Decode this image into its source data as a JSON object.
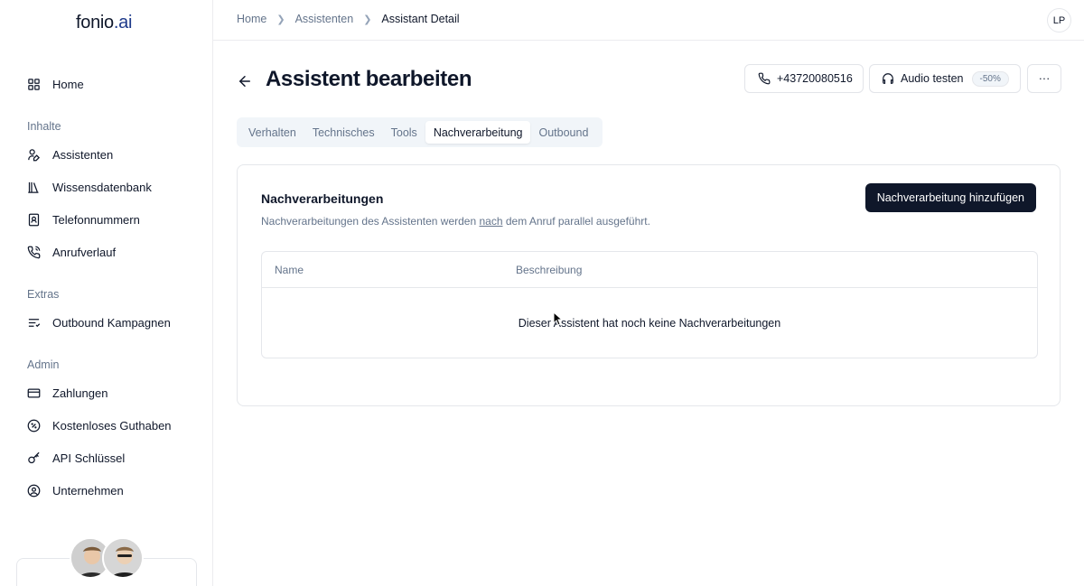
{
  "sidebar": {
    "logo_main": "fonio",
    "logo_ext": ".ai",
    "home": {
      "label": "Home",
      "icon": "grid-icon"
    },
    "sections": [
      {
        "title": "Inhalte",
        "items": [
          {
            "label": "Assistenten",
            "icon": "user-edit-icon"
          },
          {
            "label": "Wissensdatenbank",
            "icon": "library-icon"
          },
          {
            "label": "Telefonnummern",
            "icon": "contact-icon"
          },
          {
            "label": "Anrufverlauf",
            "icon": "phone-call-icon"
          }
        ]
      },
      {
        "title": "Extras",
        "items": [
          {
            "label": "Outbound Kampagnen",
            "icon": "list-icon"
          }
        ]
      },
      {
        "title": "Admin",
        "items": [
          {
            "label": "Zahlungen",
            "icon": "credit-card-icon"
          },
          {
            "label": "Kostenloses Guthaben",
            "icon": "percent-badge-icon"
          },
          {
            "label": "API Schlüssel",
            "icon": "key-icon"
          },
          {
            "label": "Unternehmen",
            "icon": "user-circle-icon"
          }
        ]
      }
    ]
  },
  "topbar": {
    "breadcrumbs": [
      "Home",
      "Assistenten",
      "Assistant Detail"
    ],
    "user_initials": "LP"
  },
  "header": {
    "title": "Assistent bearbeiten",
    "phone_number": "+43720080516",
    "audio_test_label": "Audio testen",
    "discount_badge": "-50%",
    "more_label": "···"
  },
  "tabs": [
    {
      "label": "Verhalten",
      "active": false
    },
    {
      "label": "Technisches",
      "active": false
    },
    {
      "label": "Tools",
      "active": false
    },
    {
      "label": "Nachverarbeitung",
      "active": true
    },
    {
      "label": "Outbound",
      "active": false
    }
  ],
  "card": {
    "title": "Nachverarbeitungen",
    "desc_before": "Nachverarbeitungen des Assistenten werden ",
    "desc_underline": "nach",
    "desc_after": " dem Anruf parallel ausgeführt.",
    "add_button": "Nachverarbeitung hinzufügen",
    "table": {
      "columns": [
        "Name",
        "Beschreibung"
      ],
      "empty_text": "Dieser Assistent hat noch keine Nachverarbeitungen"
    }
  },
  "colors": {
    "primary": "#0f172a",
    "muted": "#64748b",
    "border": "#e5e7eb",
    "tab_bg": "#f1f5f9"
  }
}
